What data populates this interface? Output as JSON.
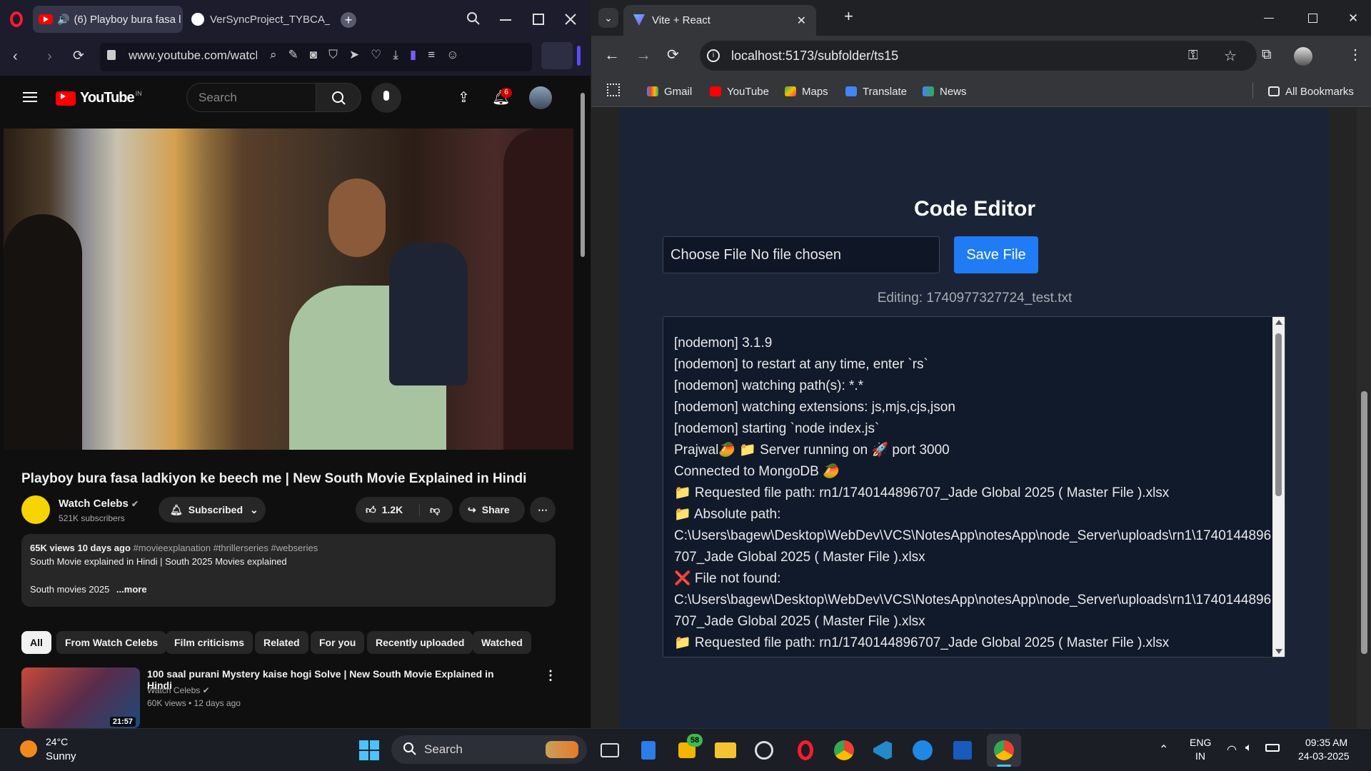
{
  "opera": {
    "tab_active": "(6) Playboy bura fasa l",
    "tab_other": "VerSyncProject_TYBCA_SE",
    "url": "www.youtube.com/watcl"
  },
  "youtube": {
    "logo_text": "YouTube",
    "country": "IN",
    "search_placeholder": "Search",
    "notif_count": "6",
    "video_title": "Playboy bura fasa ladkiyon ke beech me | New South Movie Explained in Hindi",
    "channel_name": "Watch Celebs",
    "channel_subs": "521K subscribers",
    "subscribed_label": "Subscribed",
    "like_count": "1.2K",
    "share_label": "Share",
    "desc_stats": "65K views  10 days ago",
    "desc_tags": "#movieexplanation #thrillerseries #webseries",
    "desc_line1": "South Movie explained in Hindi | South 2025 Movies explained",
    "desc_line2": "South movies 2025",
    "desc_more": "...more",
    "chips": [
      "All",
      "From Watch Celebs",
      "Film criticisms",
      "Related",
      "For you",
      "Recently uploaded",
      "Watched"
    ],
    "rec": {
      "title": "100 saal purani Mystery kaise hogi Solve | New South Movie Explained in Hindi",
      "channel": "Watch Celebs",
      "meta": "60K views • 12 days ago",
      "duration": "21:57"
    }
  },
  "chrome": {
    "tab_title": "Vite + React",
    "url": "localhost:5173/subfolder/ts15",
    "bookmarks": [
      "Gmail",
      "YouTube",
      "Maps",
      "Translate",
      "News"
    ],
    "all_bookmarks": "All Bookmarks"
  },
  "app": {
    "title": "Code Editor",
    "file_input": "Choose File No file chosen",
    "save_label": "Save File",
    "editing": "Editing: 1740977327724_test.txt",
    "editor_lines": [
      "[nodemon] 3.1.9",
      "[nodemon] to restart at any time, enter `rs`",
      "[nodemon] watching path(s): *.*",
      "[nodemon] watching extensions: js,mjs,cjs,json",
      "[nodemon] starting `node index.js`",
      "Prajwal🥭 📁 Server running on 🚀 port 3000",
      "Connected to MongoDB 🥭",
      "📁 Requested file path: rn1/1740144896707_Jade Global 2025 ( Master File ).xlsx",
      "📁 Absolute path:",
      "C:\\Users\\bagew\\Desktop\\WebDev\\VCS\\NotesApp\\notesApp\\node_Server\\uploads\\rn1\\1740144896707_Jade Global 2025 ( Master File ).xlsx",
      "❌ File not found:",
      "C:\\Users\\bagew\\Desktop\\WebDev\\VCS\\NotesApp\\notesApp\\node_Server\\uploads\\rn1\\1740144896707_Jade Global 2025 ( Master File ).xlsx",
      "📁 Requested file path: rn1/1740144896707_Jade Global 2025 ( Master File ).xlsx"
    ]
  },
  "taskbar": {
    "temp": "24°C",
    "condition": "Sunny",
    "search_label": "Search",
    "badge": "58",
    "lang1": "ENG",
    "lang2": "IN",
    "time": "09:35 AM",
    "date": "24-03-2025"
  }
}
